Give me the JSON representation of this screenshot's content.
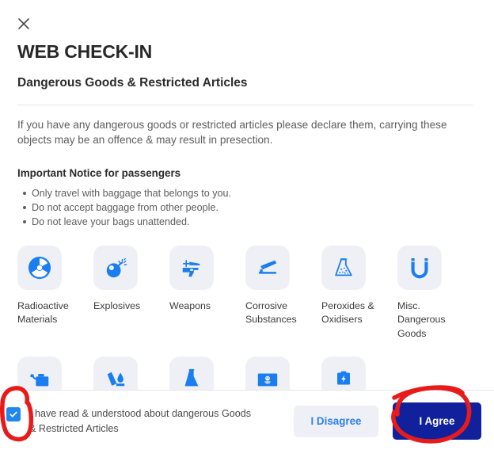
{
  "modal": {
    "close_icon": "close-icon",
    "title": "WEB CHECK-IN",
    "subtitle": "Dangerous Goods & Restricted Articles",
    "intro": "If you have any dangerous goods or restricted articles please declare them, carrying these objects may be an offence & may result in presection.",
    "notice_title": "Important Notice for passengers",
    "bullets": [
      "Only travel with baggage that belongs to you.",
      "Do not accept baggage from other people.",
      "Do not leave your bags unattended."
    ]
  },
  "icons": {
    "row1": [
      {
        "icon": "radioactive-icon",
        "label": "Radioactive Materials"
      },
      {
        "icon": "explosives-bomb-icon",
        "label": "Explosives"
      },
      {
        "icon": "weapons-gun-icon",
        "label": "Weapons"
      },
      {
        "icon": "corrosive-substances-icon",
        "label": "Corrosive Substances"
      },
      {
        "icon": "peroxides-oxidisers-flask-icon",
        "label": "Peroxides & Oxidisers"
      },
      {
        "icon": "magnet-misc-dangerous-goods-icon",
        "label": "Misc. Dangerous Goods"
      }
    ],
    "row2": [
      {
        "icon": "flammable-liquids-fuel-can-icon",
        "label": ""
      },
      {
        "icon": "flammable-solids-match-icon",
        "label": ""
      },
      {
        "icon": "toxic-flask-icon",
        "label": ""
      },
      {
        "icon": "infectious-substances-icon",
        "label": ""
      },
      {
        "icon": "lithium-battery-icon",
        "label": ""
      }
    ]
  },
  "footer": {
    "checkbox_checked": true,
    "checkbox_icon": "checkmark-icon",
    "agree_text": "I have read & understood about dangerous Goods & Restricted Articles",
    "disagree_label": "I Disagree",
    "agree_label": "I Agree"
  },
  "colors": {
    "icon_blue": "#1a7ef0",
    "tile_bg": "#eef0f5",
    "agree_button_bg": "#10219b",
    "disagree_text": "#2f80ed",
    "checkbox_bg": "#2286f0",
    "annotation_red": "#e81b1b"
  }
}
